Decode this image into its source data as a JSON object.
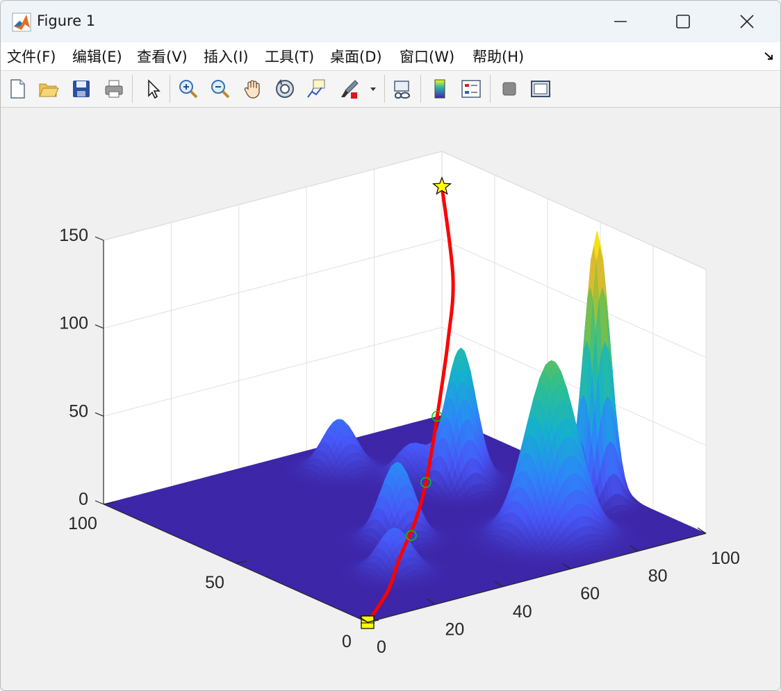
{
  "window": {
    "title": "Figure 1"
  },
  "menu": {
    "items": [
      {
        "label": "文件(F)",
        "mnemonic": "F"
      },
      {
        "label": "编辑(E)",
        "mnemonic": "E"
      },
      {
        "label": "查看(V)",
        "mnemonic": "V"
      },
      {
        "label": "插入(I)",
        "mnemonic": "I"
      },
      {
        "label": "工具(T)",
        "mnemonic": "T"
      },
      {
        "label": "桌面(D)",
        "mnemonic": "D"
      },
      {
        "label": "窗口(W)",
        "mnemonic": "W"
      },
      {
        "label": "帮助(H)",
        "mnemonic": "H"
      }
    ]
  },
  "toolbar": {
    "buttons": [
      "new-figure-icon",
      "open-icon",
      "save-icon",
      "print-icon",
      "pointer-icon",
      "zoom-in-icon",
      "zoom-out-icon",
      "pan-icon",
      "rotate-3d-icon",
      "data-cursor-icon",
      "brush-icon",
      "link-plot-icon",
      "colorbar-icon",
      "legend-icon",
      "hide-plot-tools-icon",
      "show-plot-tools-icon"
    ]
  },
  "colors": {
    "path": "#ff0000",
    "waypoint": "#00cc00",
    "start_marker": "#ffff00",
    "goal_marker": "#ffff00",
    "floor": "#3e26a8"
  },
  "chart_data": {
    "type": "surface",
    "colormap": "parula",
    "xlim": [
      0,
      100
    ],
    "ylim": [
      0,
      100
    ],
    "zlim": [
      0,
      150
    ],
    "xticks": [
      "0",
      "20",
      "40",
      "60",
      "80",
      "100"
    ],
    "yticks": [
      "0",
      "50",
      "100"
    ],
    "zticks": [
      "0",
      "50",
      "100",
      "150"
    ],
    "grid": true,
    "peaks": [
      {
        "x": 70,
        "y": 20,
        "height": 100,
        "sigma": 6
      },
      {
        "x": 92,
        "y": 31,
        "height": 155,
        "sigma": 3
      },
      {
        "x": 40,
        "y": 40,
        "height": 44,
        "sigma": 4
      },
      {
        "x": 26,
        "y": 23,
        "height": 25,
        "sigma": 4
      },
      {
        "x": 72,
        "y": 58,
        "height": 58,
        "sigma": 3.5
      },
      {
        "x": 77,
        "y": 63,
        "height": 65,
        "sigma": 3.5
      },
      {
        "x": 68,
        "y": 70,
        "height": 20,
        "sigma": 4
      },
      {
        "x": 58,
        "y": 85,
        "height": 29,
        "sigma": 4
      }
    ],
    "path": {
      "start": [
        0,
        0,
        0
      ],
      "goal": [
        100,
        100,
        130
      ],
      "points": [
        [
          0,
          0,
          0
        ],
        [
          13,
          9,
          5
        ],
        [
          25,
          20,
          10
        ],
        [
          38,
          31,
          16
        ],
        [
          48,
          40,
          24
        ],
        [
          58,
          50,
          35
        ],
        [
          68,
          60,
          50
        ],
        [
          80,
          72,
          72
        ],
        [
          90,
          83,
          95
        ],
        [
          100,
          100,
          130
        ]
      ],
      "waypoints": [
        [
          34,
          27,
          14
        ],
        [
          50,
          42,
          26
        ],
        [
          65,
          57,
          46
        ]
      ]
    }
  }
}
